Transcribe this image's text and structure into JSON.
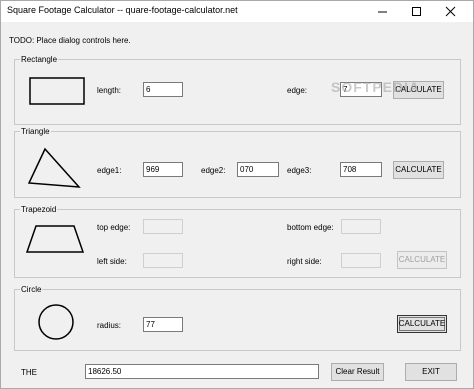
{
  "window": {
    "title": "Square Footage Calculator --  quare-footage-calculator.net"
  },
  "todo_text": "TODO: Place dialog controls here.",
  "watermark": "SOFTPEDIA",
  "rectangle": {
    "legend": "Rectangle",
    "length_label": "length:",
    "length_value": "6",
    "edge_label": "edge:",
    "edge_value": "7",
    "calculate_label": "CALCULATE"
  },
  "triangle": {
    "legend": "Triangle",
    "edge1_label": "edge1:",
    "edge1_value": "969",
    "edge2_label": "edge2:",
    "edge2_value": "070",
    "edge3_label": "edge3:",
    "edge3_value": "708",
    "calculate_label": "CALCULATE"
  },
  "trapezoid": {
    "legend": "Trapezoid",
    "top_edge_label": "top edge:",
    "bottom_edge_label": "bottom edge:",
    "left_side_label": "left side:",
    "right_side_label": "right side:",
    "calculate_label": "CALCULATE"
  },
  "circle": {
    "legend": "Circle",
    "radius_label": "radius:",
    "radius_value": "77",
    "calculate_label": "CALCULATE"
  },
  "result": {
    "label": "THE",
    "value": "18626.50",
    "clear_label": "Clear Result",
    "exit_label": "EXIT"
  },
  "icons": {
    "minimize": "minimize-icon",
    "maximize": "maximize-icon",
    "close": "close-icon"
  }
}
